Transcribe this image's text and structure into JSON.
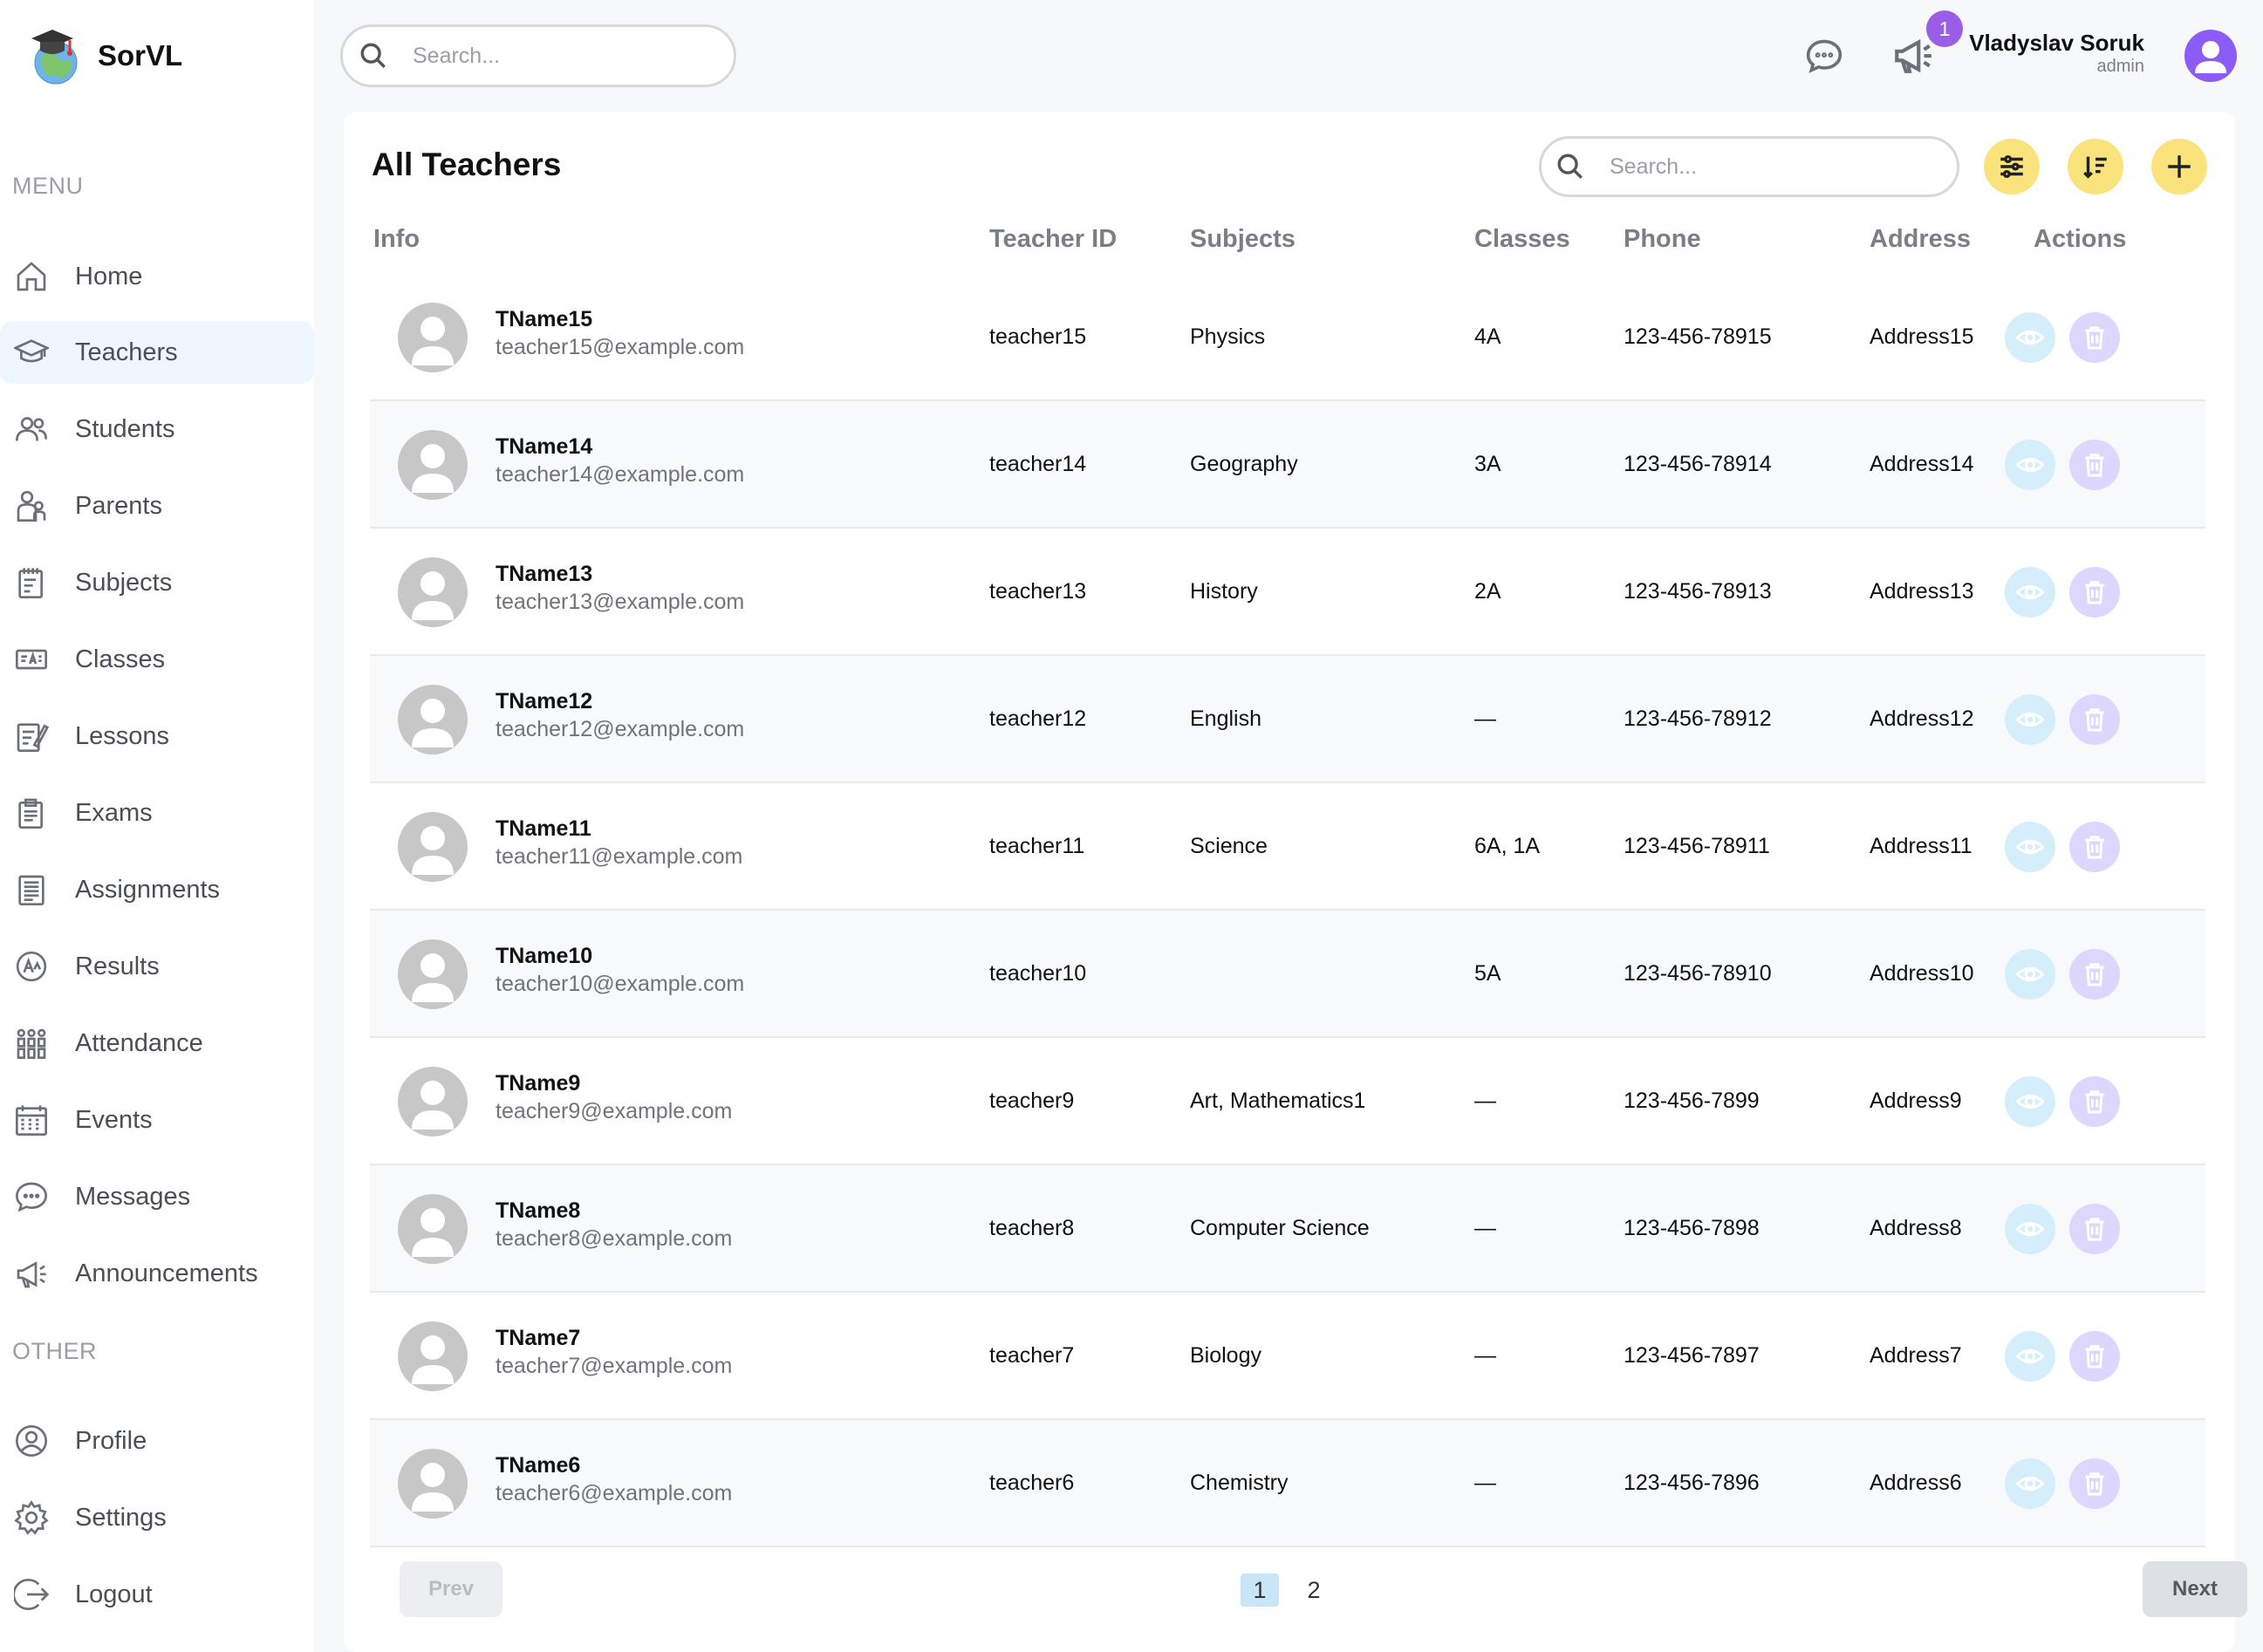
{
  "app": {
    "name": "SorVL"
  },
  "sidebar": {
    "menu_label": "MENU",
    "other_label": "OTHER",
    "items": [
      {
        "label": "Home",
        "icon": "home-icon"
      },
      {
        "label": "Teachers",
        "icon": "graduation-cap-icon",
        "active": true
      },
      {
        "label": "Students",
        "icon": "students-icon"
      },
      {
        "label": "Parents",
        "icon": "parents-icon"
      },
      {
        "label": "Subjects",
        "icon": "subjects-icon"
      },
      {
        "label": "Classes",
        "icon": "classes-icon"
      },
      {
        "label": "Lessons",
        "icon": "lessons-icon"
      },
      {
        "label": "Exams",
        "icon": "exams-icon"
      },
      {
        "label": "Assignments",
        "icon": "assignments-icon"
      },
      {
        "label": "Results",
        "icon": "results-icon"
      },
      {
        "label": "Attendance",
        "icon": "attendance-icon"
      },
      {
        "label": "Events",
        "icon": "calendar-icon"
      },
      {
        "label": "Messages",
        "icon": "message-icon"
      },
      {
        "label": "Announcements",
        "icon": "megaphone-icon"
      }
    ],
    "other_items": [
      {
        "label": "Profile",
        "icon": "profile-icon"
      },
      {
        "label": "Settings",
        "icon": "gear-icon"
      },
      {
        "label": "Logout",
        "icon": "logout-icon"
      }
    ]
  },
  "topbar": {
    "search_placeholder": "Search...",
    "notification_count": "1",
    "user_name": "Vladyslav Soruk",
    "user_role": "admin"
  },
  "main": {
    "title": "All Teachers",
    "search_placeholder": "Search...",
    "columns": [
      "Info",
      "Teacher ID",
      "Subjects",
      "Classes",
      "Phone",
      "Address",
      "Actions"
    ],
    "rows": [
      {
        "name": "TName15",
        "email": "teacher15@example.com",
        "id": "teacher15",
        "subjects": "Physics",
        "classes": "4A",
        "phone": "123-456-78915",
        "address": "Address15"
      },
      {
        "name": "TName14",
        "email": "teacher14@example.com",
        "id": "teacher14",
        "subjects": "Geography",
        "classes": "3A",
        "phone": "123-456-78914",
        "address": "Address14"
      },
      {
        "name": "TName13",
        "email": "teacher13@example.com",
        "id": "teacher13",
        "subjects": "History",
        "classes": "2A",
        "phone": "123-456-78913",
        "address": "Address13"
      },
      {
        "name": "TName12",
        "email": "teacher12@example.com",
        "id": "teacher12",
        "subjects": "English",
        "classes": "—",
        "phone": "123-456-78912",
        "address": "Address12"
      },
      {
        "name": "TName11",
        "email": "teacher11@example.com",
        "id": "teacher11",
        "subjects": "Science",
        "classes": "6A, 1A",
        "phone": "123-456-78911",
        "address": "Address11"
      },
      {
        "name": "TName10",
        "email": "teacher10@example.com",
        "id": "teacher10",
        "subjects": "",
        "classes": "5A",
        "phone": "123-456-78910",
        "address": "Address10"
      },
      {
        "name": "TName9",
        "email": "teacher9@example.com",
        "id": "teacher9",
        "subjects": "Art, Mathematics1",
        "classes": "—",
        "phone": "123-456-7899",
        "address": "Address9"
      },
      {
        "name": "TName8",
        "email": "teacher8@example.com",
        "id": "teacher8",
        "subjects": "Computer Science",
        "classes": "—",
        "phone": "123-456-7898",
        "address": "Address8"
      },
      {
        "name": "TName7",
        "email": "teacher7@example.com",
        "id": "teacher7",
        "subjects": "Biology",
        "classes": "—",
        "phone": "123-456-7897",
        "address": "Address7"
      },
      {
        "name": "TName6",
        "email": "teacher6@example.com",
        "id": "teacher6",
        "subjects": "Chemistry",
        "classes": "—",
        "phone": "123-456-7896",
        "address": "Address6"
      }
    ]
  },
  "pagination": {
    "prev_label": "Prev",
    "next_label": "Next",
    "pages": [
      "1",
      "2"
    ],
    "current": "1"
  },
  "colors": {
    "accent_yellow": "#fae27c",
    "view_button": "#d5eefb",
    "delete_button": "#ddd6fe",
    "badge_purple": "#9b5de5",
    "active_nav_bg": "#edf7fd"
  }
}
